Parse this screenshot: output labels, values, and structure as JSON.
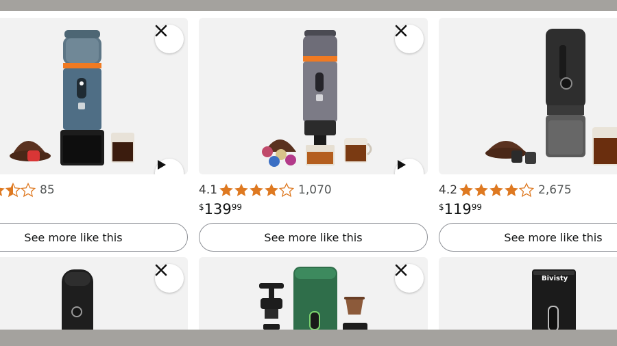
{
  "theme": {
    "accent_star": "#de7921",
    "card_bg": "#f2f2f2",
    "frame": "#a4a29e"
  },
  "products": [
    {
      "rating": "",
      "review_count": "85",
      "stars_filled": 3.5,
      "price_currency": "",
      "price_whole": "",
      "price_fraction": "",
      "see_more_label": "See more like this",
      "icons": [
        "close-icon",
        "play-icon"
      ]
    },
    {
      "rating": "4.1",
      "review_count": "1,070",
      "stars_filled": 4,
      "price_currency": "$",
      "price_whole": "139",
      "price_fraction": "99",
      "see_more_label": "See more like this",
      "icons": [
        "close-icon",
        "play-icon"
      ]
    },
    {
      "rating": "4.2",
      "review_count": "2,675",
      "stars_filled": 4,
      "price_currency": "$",
      "price_whole": "119",
      "price_fraction": "99",
      "see_more_label": "See more like this",
      "icons": []
    }
  ],
  "second_row": [
    {
      "icons": [
        "close-icon"
      ],
      "logo_text": ""
    },
    {
      "icons": [
        "close-icon"
      ],
      "logo_text": ""
    },
    {
      "icons": [],
      "logo_text": "Bivisty"
    }
  ]
}
